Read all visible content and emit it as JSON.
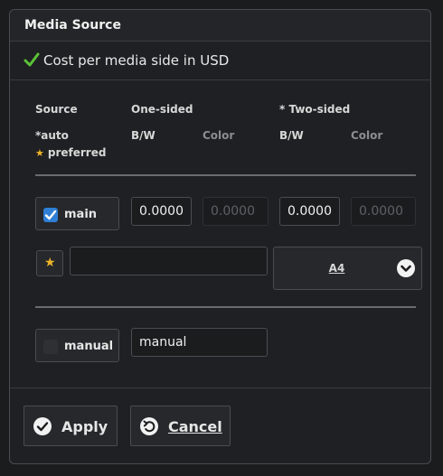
{
  "panel": {
    "title": "Media Source"
  },
  "subheader": {
    "text": "Cost per media side in USD"
  },
  "columns": {
    "source": "Source",
    "one_sided": "One-sided",
    "two_sided": "* Two-sided",
    "bw": "B/W",
    "color": "Color"
  },
  "legend": {
    "auto": "*auto",
    "preferred": "preferred"
  },
  "rows": {
    "main": {
      "label": "main",
      "checked": true,
      "one_sided_bw": "0.0000",
      "one_sided_color": "0.0000",
      "two_sided_bw": "0.0000",
      "two_sided_color": "0.0000"
    },
    "preferred": {
      "name_value": "",
      "media_size": "A4"
    },
    "manual": {
      "label": "manual",
      "checked": false,
      "name_value": "manual"
    }
  },
  "actions": {
    "apply": "Apply",
    "cancel": "Cancel"
  },
  "colors": {
    "accent_check": "#5bc236",
    "checkbox_on": "#2f7fd6",
    "star": "#f0b429",
    "background": "#1f2023"
  }
}
